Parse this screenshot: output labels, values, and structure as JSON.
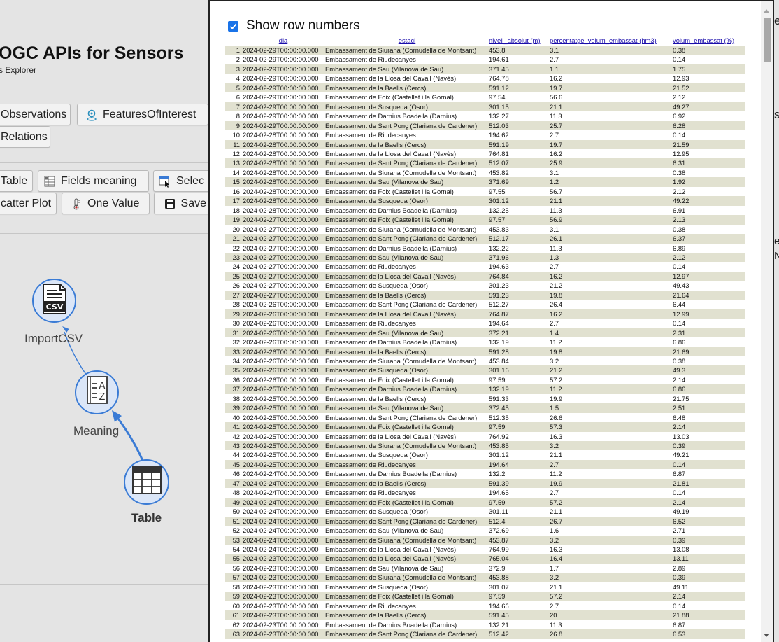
{
  "app": {
    "title": "OGC APIs for Sensors",
    "subtitle": "s Explorer",
    "buttons": {
      "observations": "Observations",
      "features_of_interest": "FeaturesOfInterest",
      "relations": "Relations",
      "table": "Table",
      "fields_meaning": "Fields meaning",
      "select": "Selec",
      "scatter_plot": "catter Plot",
      "one_value": "One Value",
      "save": "Save"
    },
    "graph_nodes": {
      "import_csv": "ImportCSV",
      "import_csv_icon_text": "CSV",
      "meaning": "Meaning",
      "table": "Table"
    },
    "right_fragments": [
      "e",
      "s",
      "ec",
      "N"
    ]
  },
  "modal": {
    "show_row_numbers_label": "Show row numbers",
    "show_row_numbers_checked": true,
    "columns": [
      {
        "name": "dia",
        "unit": ""
      },
      {
        "name": "estaci",
        "unit": ""
      },
      {
        "name": "nivell_absolut",
        "unit": "(m)"
      },
      {
        "name": "percentatge_volum_embassat",
        "unit": "(hm3)"
      },
      {
        "name": "volum_embassat",
        "unit": "(%)"
      }
    ],
    "rows": [
      [
        "1",
        "2024-02-29T00:00:00.000",
        "Embassament de Siurana (Cornudella de Montsant)",
        "453.8",
        "3.1",
        "0.38"
      ],
      [
        "2",
        "2024-02-29T00:00:00.000",
        "Embassament de Riudecanyes",
        "194.61",
        "2.7",
        "0.14"
      ],
      [
        "3",
        "2024-02-29T00:00:00.000",
        "Embassament de Sau (Vilanova de Sau)",
        "371.45",
        "1.1",
        "1.75"
      ],
      [
        "4",
        "2024-02-29T00:00:00.000",
        "Embassament de la Llosa del Cavall (Navès)",
        "764.78",
        "16.2",
        "12.93"
      ],
      [
        "5",
        "2024-02-29T00:00:00.000",
        "Embassament de la Baells (Cercs)",
        "591.12",
        "19.7",
        "21.52"
      ],
      [
        "6",
        "2024-02-29T00:00:00.000",
        "Embassament de Foix (Castellet i la Gornal)",
        "97.54",
        "56.6",
        "2.12"
      ],
      [
        "7",
        "2024-02-29T00:00:00.000",
        "Embassament de Susqueda (Osor)",
        "301.15",
        "21.1",
        "49.27"
      ],
      [
        "8",
        "2024-02-29T00:00:00.000",
        "Embassament de Darnius Boadella (Darnius)",
        "132.27",
        "11.3",
        "6.92"
      ],
      [
        "9",
        "2024-02-29T00:00:00.000",
        "Embassament de Sant Ponç (Clariana de Cardener)",
        "512.03",
        "25.7",
        "6.28"
      ],
      [
        "10",
        "2024-02-28T00:00:00.000",
        "Embassament de Riudecanyes",
        "194.62",
        "2.7",
        "0.14"
      ],
      [
        "11",
        "2024-02-28T00:00:00.000",
        "Embassament de la Baells (Cercs)",
        "591.19",
        "19.7",
        "21.59"
      ],
      [
        "12",
        "2024-02-28T00:00:00.000",
        "Embassament de la Llosa del Cavall (Navès)",
        "764.81",
        "16.2",
        "12.95"
      ],
      [
        "13",
        "2024-02-28T00:00:00.000",
        "Embassament de Sant Ponç (Clariana de Cardener)",
        "512.07",
        "25.9",
        "6.31"
      ],
      [
        "14",
        "2024-02-28T00:00:00.000",
        "Embassament de Siurana (Cornudella de Montsant)",
        "453.82",
        "3.1",
        "0.38"
      ],
      [
        "15",
        "2024-02-28T00:00:00.000",
        "Embassament de Sau (Vilanova de Sau)",
        "371.69",
        "1.2",
        "1.92"
      ],
      [
        "16",
        "2024-02-28T00:00:00.000",
        "Embassament de Foix (Castellet i la Gornal)",
        "97.55",
        "56.7",
        "2.12"
      ],
      [
        "17",
        "2024-02-28T00:00:00.000",
        "Embassament de Susqueda (Osor)",
        "301.12",
        "21.1",
        "49.22"
      ],
      [
        "18",
        "2024-02-28T00:00:00.000",
        "Embassament de Darnius Boadella (Darnius)",
        "132.25",
        "11.3",
        "6.91"
      ],
      [
        "19",
        "2024-02-27T00:00:00.000",
        "Embassament de Foix (Castellet i la Gornal)",
        "97.57",
        "56.9",
        "2.13"
      ],
      [
        "20",
        "2024-02-27T00:00:00.000",
        "Embassament de Siurana (Cornudella de Montsant)",
        "453.83",
        "3.1",
        "0.38"
      ],
      [
        "21",
        "2024-02-27T00:00:00.000",
        "Embassament de Sant Ponç (Clariana de Cardener)",
        "512.17",
        "26.1",
        "6.37"
      ],
      [
        "22",
        "2024-02-27T00:00:00.000",
        "Embassament de Darnius Boadella (Darnius)",
        "132.22",
        "11.3",
        "6.89"
      ],
      [
        "23",
        "2024-02-27T00:00:00.000",
        "Embassament de Sau (Vilanova de Sau)",
        "371.96",
        "1.3",
        "2.12"
      ],
      [
        "24",
        "2024-02-27T00:00:00.000",
        "Embassament de Riudecanyes",
        "194.63",
        "2.7",
        "0.14"
      ],
      [
        "25",
        "2024-02-27T00:00:00.000",
        "Embassament de la Llosa del Cavall (Navès)",
        "764.84",
        "16.2",
        "12.97"
      ],
      [
        "26",
        "2024-02-27T00:00:00.000",
        "Embassament de Susqueda (Osor)",
        "301.23",
        "21.2",
        "49.43"
      ],
      [
        "27",
        "2024-02-27T00:00:00.000",
        "Embassament de la Baells (Cercs)",
        "591.23",
        "19.8",
        "21.64"
      ],
      [
        "28",
        "2024-02-26T00:00:00.000",
        "Embassament de Sant Ponç (Clariana de Cardener)",
        "512.27",
        "26.4",
        "6.44"
      ],
      [
        "29",
        "2024-02-26T00:00:00.000",
        "Embassament de la Llosa del Cavall (Navès)",
        "764.87",
        "16.2",
        "12.99"
      ],
      [
        "30",
        "2024-02-26T00:00:00.000",
        "Embassament de Riudecanyes",
        "194.64",
        "2.7",
        "0.14"
      ],
      [
        "31",
        "2024-02-26T00:00:00.000",
        "Embassament de Sau (Vilanova de Sau)",
        "372.21",
        "1.4",
        "2.31"
      ],
      [
        "32",
        "2024-02-26T00:00:00.000",
        "Embassament de Darnius Boadella (Darnius)",
        "132.19",
        "11.2",
        "6.86"
      ],
      [
        "33",
        "2024-02-26T00:00:00.000",
        "Embassament de la Baells (Cercs)",
        "591.28",
        "19.8",
        "21.69"
      ],
      [
        "34",
        "2024-02-26T00:00:00.000",
        "Embassament de Siurana (Cornudella de Montsant)",
        "453.84",
        "3.2",
        "0.38"
      ],
      [
        "35",
        "2024-02-26T00:00:00.000",
        "Embassament de Susqueda (Osor)",
        "301.16",
        "21.2",
        "49.3"
      ],
      [
        "36",
        "2024-02-26T00:00:00.000",
        "Embassament de Foix (Castellet i la Gornal)",
        "97.59",
        "57.2",
        "2.14"
      ],
      [
        "37",
        "2024-02-25T00:00:00.000",
        "Embassament de Darnius Boadella (Darnius)",
        "132.19",
        "11.2",
        "6.86"
      ],
      [
        "38",
        "2024-02-25T00:00:00.000",
        "Embassament de la Baells (Cercs)",
        "591.33",
        "19.9",
        "21.75"
      ],
      [
        "39",
        "2024-02-25T00:00:00.000",
        "Embassament de Sau (Vilanova de Sau)",
        "372.45",
        "1.5",
        "2.51"
      ],
      [
        "40",
        "2024-02-25T00:00:00.000",
        "Embassament de Sant Ponç (Clariana de Cardener)",
        "512.35",
        "26.6",
        "6.48"
      ],
      [
        "41",
        "2024-02-25T00:00:00.000",
        "Embassament de Foix (Castellet i la Gornal)",
        "97.59",
        "57.3",
        "2.14"
      ],
      [
        "42",
        "2024-02-25T00:00:00.000",
        "Embassament de la Llosa del Cavall (Navès)",
        "764.92",
        "16.3",
        "13.03"
      ],
      [
        "43",
        "2024-02-25T00:00:00.000",
        "Embassament de Siurana (Cornudella de Montsant)",
        "453.85",
        "3.2",
        "0.39"
      ],
      [
        "44",
        "2024-02-25T00:00:00.000",
        "Embassament de Susqueda (Osor)",
        "301.12",
        "21.1",
        "49.21"
      ],
      [
        "45",
        "2024-02-25T00:00:00.000",
        "Embassament de Riudecanyes",
        "194.64",
        "2.7",
        "0.14"
      ],
      [
        "46",
        "2024-02-24T00:00:00.000",
        "Embassament de Darnius Boadella (Darnius)",
        "132.2",
        "11.2",
        "6.87"
      ],
      [
        "47",
        "2024-02-24T00:00:00.000",
        "Embassament de la Baells (Cercs)",
        "591.39",
        "19.9",
        "21.81"
      ],
      [
        "48",
        "2024-02-24T00:00:00.000",
        "Embassament de Riudecanyes",
        "194.65",
        "2.7",
        "0.14"
      ],
      [
        "49",
        "2024-02-24T00:00:00.000",
        "Embassament de Foix (Castellet i la Gornal)",
        "97.59",
        "57.2",
        "2.14"
      ],
      [
        "50",
        "2024-02-24T00:00:00.000",
        "Embassament de Susqueda (Osor)",
        "301.11",
        "21.1",
        "49.19"
      ],
      [
        "51",
        "2024-02-24T00:00:00.000",
        "Embassament de Sant Ponç (Clariana de Cardener)",
        "512.4",
        "26.7",
        "6.52"
      ],
      [
        "52",
        "2024-02-24T00:00:00.000",
        "Embassament de Sau (Vilanova de Sau)",
        "372.69",
        "1.6",
        "2.71"
      ],
      [
        "53",
        "2024-02-24T00:00:00.000",
        "Embassament de Siurana (Cornudella de Montsant)",
        "453.87",
        "3.2",
        "0.39"
      ],
      [
        "54",
        "2024-02-24T00:00:00.000",
        "Embassament de la Llosa del Cavall (Navès)",
        "764.99",
        "16.3",
        "13.08"
      ],
      [
        "55",
        "2024-02-23T00:00:00.000",
        "Embassament de la Llosa del Cavall (Navès)",
        "765.04",
        "16.4",
        "13.11"
      ],
      [
        "56",
        "2024-02-23T00:00:00.000",
        "Embassament de Sau (Vilanova de Sau)",
        "372.9",
        "1.7",
        "2.89"
      ],
      [
        "57",
        "2024-02-23T00:00:00.000",
        "Embassament de Siurana (Cornudella de Montsant)",
        "453.88",
        "3.2",
        "0.39"
      ],
      [
        "58",
        "2024-02-23T00:00:00.000",
        "Embassament de Susqueda (Osor)",
        "301.07",
        "21.1",
        "49.11"
      ],
      [
        "59",
        "2024-02-23T00:00:00.000",
        "Embassament de Foix (Castellet i la Gornal)",
        "97.59",
        "57.2",
        "2.14"
      ],
      [
        "60",
        "2024-02-23T00:00:00.000",
        "Embassament de Riudecanyes",
        "194.66",
        "2.7",
        "0.14"
      ],
      [
        "61",
        "2024-02-23T00:00:00.000",
        "Embassament de la Baells (Cercs)",
        "591.45",
        "20",
        "21.88"
      ],
      [
        "62",
        "2024-02-23T00:00:00.000",
        "Embassament de Darnius Boadella (Darnius)",
        "132.21",
        "11.3",
        "6.87"
      ],
      [
        "63",
        "2024-02-23T00:00:00.000",
        "Embassament de Sant Ponç (Clariana de Cardener)",
        "512.42",
        "26.8",
        "6.53"
      ]
    ]
  },
  "colors": {
    "row_alt_bg": "#e1e1d0",
    "header_link": "#1a0dab",
    "node_fill": "#dbe6f7",
    "node_border": "#3a7bd5",
    "edge": "#3a7bd5",
    "checkbox": "#1a73e8"
  },
  "icons": [
    "document-csv-icon",
    "dictionary-az-icon",
    "table-grid-icon",
    "location-pin-icon",
    "grid-table-icon",
    "thermometer-icon",
    "select-cursor-icon",
    "save-disk-icon"
  ]
}
